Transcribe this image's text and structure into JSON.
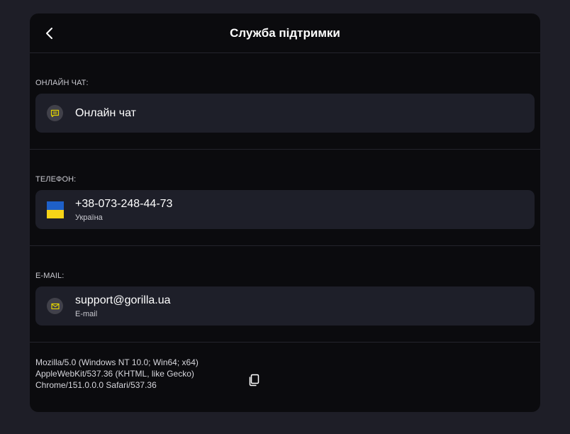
{
  "header": {
    "title": "Служба підтримки",
    "back_icon": "chevron-left-icon"
  },
  "sections": {
    "chat": {
      "label": "ОНЛАЙН ЧАТ:",
      "title": "Онлайн чат",
      "icon": "chat-icon"
    },
    "phone": {
      "label": "ТЕЛЕФОН:",
      "number": "+38-073-248-44-73",
      "country": "Україна",
      "icon": "ukraine-flag-icon"
    },
    "email": {
      "label": "E-MAIL:",
      "address": "support@gorilla.ua",
      "type": "E-mail",
      "icon": "mail-icon"
    }
  },
  "footer": {
    "user_agent_lines": [
      "Mozilla/5.0 (Windows NT 10.0; Win64; x64)",
      "AppleWebKit/537.36 (KHTML, like Gecko)",
      "Chrome/151.0.0.0 Safari/537.36"
    ],
    "copy_icon": "copy-icon"
  },
  "colors": {
    "background": "#1e1e27",
    "panel": "#0b0b0e",
    "card": "#1e1f29",
    "accent": "#e3d400",
    "flag_blue": "#1e60c8",
    "flag_yellow": "#f7d417"
  }
}
